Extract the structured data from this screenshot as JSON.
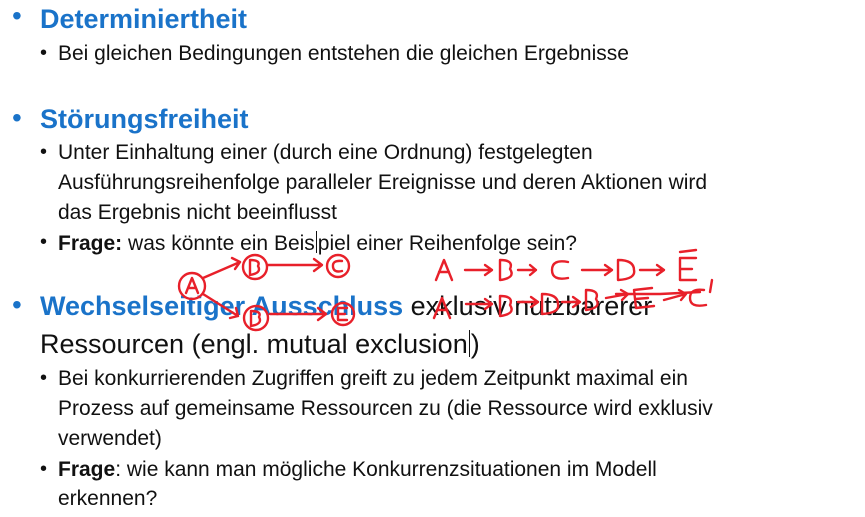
{
  "sections": [
    {
      "heading": "Determiniertheit",
      "items": [
        {
          "lines": [
            "Bei gleichen Bedingungen entstehen die gleichen Ergebnisse"
          ]
        }
      ]
    },
    {
      "heading": "Störungsfreiheit",
      "items": [
        {
          "lines": [
            "Unter Einhaltung einer (durch eine Ordnung) festgelegten",
            "Ausführungsreihenfolge paralleler Ereignisse und deren Aktionen wird",
            "das Ergebnis nicht beeinflusst"
          ]
        },
        {
          "label": "Frage:",
          "text_before_cursor": " was könnte ein Beis",
          "text_after_cursor": "piel einer Reihenfolge sein?"
        }
      ]
    },
    {
      "heading": "Wechselseitiger Ausschluss",
      "heading_rest": " exklusiv nutzbarerer",
      "heading_line2_before_cursor": "Ressourcen (engl. mutual exclusion",
      "heading_line2_after_cursor": ")",
      "items": [
        {
          "lines": [
            "Bei konkurrierenden Zugriffen greift zu jedem Zeitpunkt maximal ein",
            "Prozess auf gemeinsame Ressourcen zu (die Ressource wird exklusiv",
            "verwendet)"
          ]
        },
        {
          "label": "Frage",
          "lines": [
            ": wie kann man mögliche Konkurrenzsituationen im Modell",
            "erkennen?"
          ]
        }
      ]
    }
  ],
  "bullets": {
    "level1": "•",
    "level2": "•"
  },
  "ink_annotations": {
    "color": "#e8202a",
    "sequence_1": "A → B → C → D → E",
    "sequence_2": "A → B → D → B → E → C'"
  }
}
